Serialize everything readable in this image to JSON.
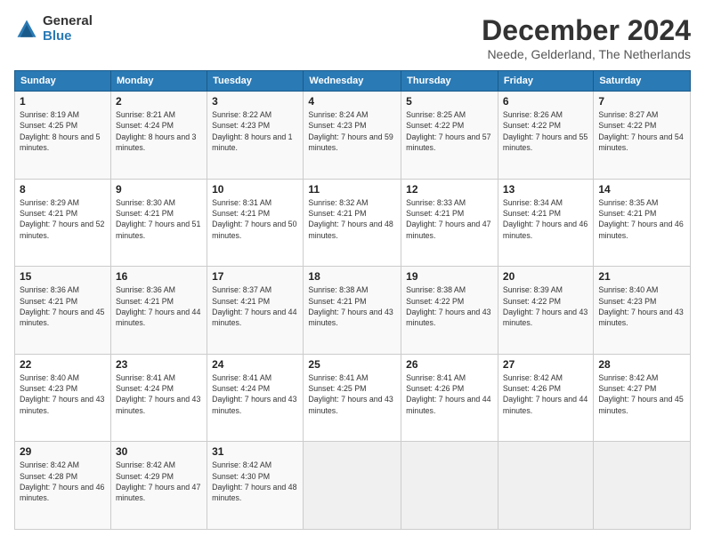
{
  "logo": {
    "general": "General",
    "blue": "Blue"
  },
  "title": "December 2024",
  "subtitle": "Neede, Gelderland, The Netherlands",
  "headers": [
    "Sunday",
    "Monday",
    "Tuesday",
    "Wednesday",
    "Thursday",
    "Friday",
    "Saturday"
  ],
  "weeks": [
    [
      {
        "day": "1",
        "sunrise": "8:19 AM",
        "sunset": "4:25 PM",
        "daylight": "8 hours and 5 minutes."
      },
      {
        "day": "2",
        "sunrise": "8:21 AM",
        "sunset": "4:24 PM",
        "daylight": "8 hours and 3 minutes."
      },
      {
        "day": "3",
        "sunrise": "8:22 AM",
        "sunset": "4:23 PM",
        "daylight": "8 hours and 1 minute."
      },
      {
        "day": "4",
        "sunrise": "8:24 AM",
        "sunset": "4:23 PM",
        "daylight": "7 hours and 59 minutes."
      },
      {
        "day": "5",
        "sunrise": "8:25 AM",
        "sunset": "4:22 PM",
        "daylight": "7 hours and 57 minutes."
      },
      {
        "day": "6",
        "sunrise": "8:26 AM",
        "sunset": "4:22 PM",
        "daylight": "7 hours and 55 minutes."
      },
      {
        "day": "7",
        "sunrise": "8:27 AM",
        "sunset": "4:22 PM",
        "daylight": "7 hours and 54 minutes."
      }
    ],
    [
      {
        "day": "8",
        "sunrise": "8:29 AM",
        "sunset": "4:21 PM",
        "daylight": "7 hours and 52 minutes."
      },
      {
        "day": "9",
        "sunrise": "8:30 AM",
        "sunset": "4:21 PM",
        "daylight": "7 hours and 51 minutes."
      },
      {
        "day": "10",
        "sunrise": "8:31 AM",
        "sunset": "4:21 PM",
        "daylight": "7 hours and 50 minutes."
      },
      {
        "day": "11",
        "sunrise": "8:32 AM",
        "sunset": "4:21 PM",
        "daylight": "7 hours and 48 minutes."
      },
      {
        "day": "12",
        "sunrise": "8:33 AM",
        "sunset": "4:21 PM",
        "daylight": "7 hours and 47 minutes."
      },
      {
        "day": "13",
        "sunrise": "8:34 AM",
        "sunset": "4:21 PM",
        "daylight": "7 hours and 46 minutes."
      },
      {
        "day": "14",
        "sunrise": "8:35 AM",
        "sunset": "4:21 PM",
        "daylight": "7 hours and 46 minutes."
      }
    ],
    [
      {
        "day": "15",
        "sunrise": "8:36 AM",
        "sunset": "4:21 PM",
        "daylight": "7 hours and 45 minutes."
      },
      {
        "day": "16",
        "sunrise": "8:36 AM",
        "sunset": "4:21 PM",
        "daylight": "7 hours and 44 minutes."
      },
      {
        "day": "17",
        "sunrise": "8:37 AM",
        "sunset": "4:21 PM",
        "daylight": "7 hours and 44 minutes."
      },
      {
        "day": "18",
        "sunrise": "8:38 AM",
        "sunset": "4:21 PM",
        "daylight": "7 hours and 43 minutes."
      },
      {
        "day": "19",
        "sunrise": "8:38 AM",
        "sunset": "4:22 PM",
        "daylight": "7 hours and 43 minutes."
      },
      {
        "day": "20",
        "sunrise": "8:39 AM",
        "sunset": "4:22 PM",
        "daylight": "7 hours and 43 minutes."
      },
      {
        "day": "21",
        "sunrise": "8:40 AM",
        "sunset": "4:23 PM",
        "daylight": "7 hours and 43 minutes."
      }
    ],
    [
      {
        "day": "22",
        "sunrise": "8:40 AM",
        "sunset": "4:23 PM",
        "daylight": "7 hours and 43 minutes."
      },
      {
        "day": "23",
        "sunrise": "8:41 AM",
        "sunset": "4:24 PM",
        "daylight": "7 hours and 43 minutes."
      },
      {
        "day": "24",
        "sunrise": "8:41 AM",
        "sunset": "4:24 PM",
        "daylight": "7 hours and 43 minutes."
      },
      {
        "day": "25",
        "sunrise": "8:41 AM",
        "sunset": "4:25 PM",
        "daylight": "7 hours and 43 minutes."
      },
      {
        "day": "26",
        "sunrise": "8:41 AM",
        "sunset": "4:26 PM",
        "daylight": "7 hours and 44 minutes."
      },
      {
        "day": "27",
        "sunrise": "8:42 AM",
        "sunset": "4:26 PM",
        "daylight": "7 hours and 44 minutes."
      },
      {
        "day": "28",
        "sunrise": "8:42 AM",
        "sunset": "4:27 PM",
        "daylight": "7 hours and 45 minutes."
      }
    ],
    [
      {
        "day": "29",
        "sunrise": "8:42 AM",
        "sunset": "4:28 PM",
        "daylight": "7 hours and 46 minutes."
      },
      {
        "day": "30",
        "sunrise": "8:42 AM",
        "sunset": "4:29 PM",
        "daylight": "7 hours and 47 minutes."
      },
      {
        "day": "31",
        "sunrise": "8:42 AM",
        "sunset": "4:30 PM",
        "daylight": "7 hours and 48 minutes."
      },
      null,
      null,
      null,
      null
    ]
  ]
}
